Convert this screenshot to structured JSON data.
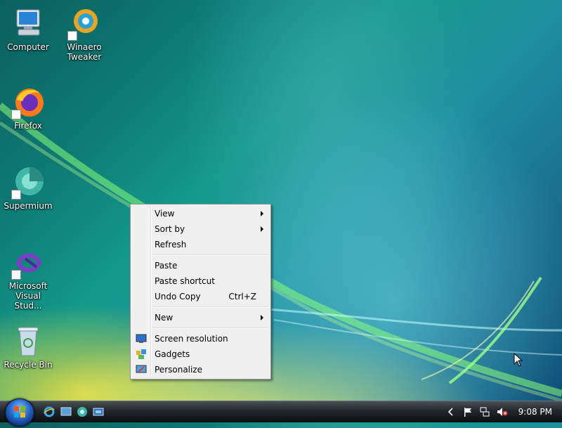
{
  "desktop": {
    "icons": [
      {
        "label": "Computer"
      },
      {
        "label": "Winaero\nTweaker"
      },
      {
        "label": "Firefox"
      },
      {
        "label": "Supermium"
      },
      {
        "label": "Microsoft\nVisual Stud..."
      },
      {
        "label": "Recycle Bin"
      }
    ]
  },
  "context_menu": {
    "items": {
      "view": "View",
      "sort_by": "Sort by",
      "refresh": "Refresh",
      "paste": "Paste",
      "paste_shortcut": "Paste shortcut",
      "undo_copy": "Undo Copy",
      "undo_copy_shortcut": "Ctrl+Z",
      "new": "New",
      "screen_resolution": "Screen resolution",
      "gadgets": "Gadgets",
      "personalize": "Personalize"
    }
  },
  "taskbar": {
    "clock": "9:08 PM"
  }
}
